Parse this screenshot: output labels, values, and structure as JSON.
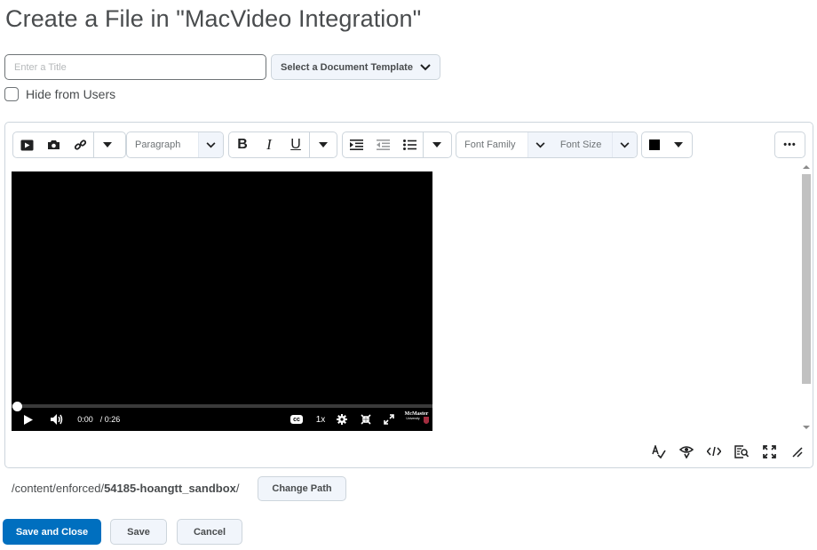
{
  "page": {
    "title": "Create a File in \"MacVideo Integration\""
  },
  "form": {
    "title_placeholder": "Enter a Title",
    "template_button": "Select a Document Template",
    "hide_label": "Hide from Users"
  },
  "toolbar": {
    "paragraph_label": "Paragraph",
    "font_family_label": "Font Family",
    "font_size_label": "Font Size",
    "bold": "B",
    "italic": "I",
    "underline": "U",
    "more": "•••",
    "color_value": "#000000"
  },
  "video": {
    "current_time": "0:00",
    "duration": "/ 0:26",
    "speed": "1x",
    "cc": "cc",
    "logo_text": "McMaster",
    "progress": 0
  },
  "path": {
    "prefix": "/content/enforced/",
    "folder": "54185-hoangtt_sandbox",
    "suffix": "/",
    "change_button": "Change Path"
  },
  "actions": {
    "save_close": "Save and Close",
    "save": "Save",
    "cancel": "Cancel"
  },
  "colors": {
    "primary": "#006fbf",
    "border": "#cdd5dc",
    "button_bg": "#f1f5fb",
    "text": "#494c4e"
  },
  "icons": {
    "insert_video": "video-icon",
    "insert_image": "camera-icon",
    "insert_link": "link-icon",
    "spellcheck": "spellcheck-icon",
    "accessibility": "accessibility-eye-icon",
    "source_code": "code-icon",
    "preview": "preview-icon",
    "fullscreen": "fullscreen-icon",
    "resize": "resize-handle-icon"
  }
}
